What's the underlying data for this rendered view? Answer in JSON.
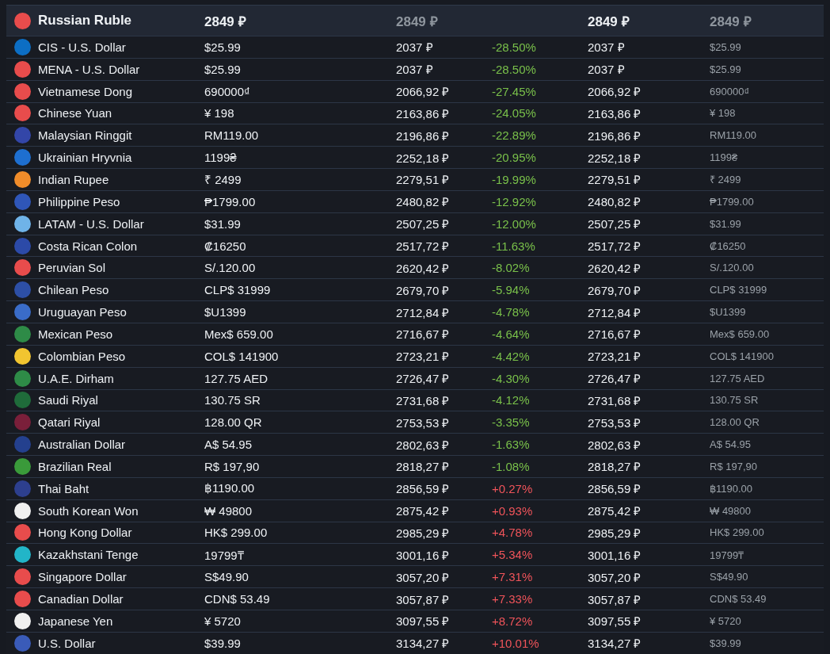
{
  "header": {
    "currency": "Russian Ruble",
    "color": "#e84c4c",
    "price": "2849 ₽",
    "converted": "2849 ₽",
    "converted_again": "2849 ₽",
    "original": "2849 ₽"
  },
  "rows": [
    {
      "currency": "CIS - U.S. Dollar",
      "color": "#0c6ec4",
      "price": "$25.99",
      "converted": "2037 ₽",
      "diff": {
        "text": "-28.50%",
        "color": "#79c04a"
      },
      "converted_again": "2037 ₽",
      "original": "$25.99"
    },
    {
      "currency": "MENA - U.S. Dollar",
      "color": "#e84c4c",
      "price": "$25.99",
      "converted": "2037 ₽",
      "diff": {
        "text": "-28.50%",
        "color": "#79c04a"
      },
      "converted_again": "2037 ₽",
      "original": "$25.99"
    },
    {
      "currency": "Vietnamese Dong",
      "color": "#e84c4c",
      "price": "690000₫",
      "converted": "2066,92 ₽",
      "diff": {
        "text": "-27.45%",
        "color": "#79c04a"
      },
      "converted_again": "2066,92 ₽",
      "original": "690000₫"
    },
    {
      "currency": "Chinese Yuan",
      "color": "#e84c4c",
      "price": "¥ 198",
      "converted": "2163,86 ₽",
      "diff": {
        "text": "-24.05%",
        "color": "#79c04a"
      },
      "converted_again": "2163,86 ₽",
      "original": "¥ 198"
    },
    {
      "currency": "Malaysian Ringgit",
      "color": "#3346a8",
      "price": "RM119.00",
      "converted": "2196,86 ₽",
      "diff": {
        "text": "-22.89%",
        "color": "#79c04a"
      },
      "converted_again": "2196,86 ₽",
      "original": "RM119.00"
    },
    {
      "currency": "Ukrainian Hryvnia",
      "color": "#1e6fd0",
      "price": "1199₴",
      "converted": "2252,18 ₽",
      "diff": {
        "text": "-20.95%",
        "color": "#79c04a"
      },
      "converted_again": "2252,18 ₽",
      "original": "1199₴"
    },
    {
      "currency": "Indian Rupee",
      "color": "#f08c2a",
      "price": "₹ 2499",
      "converted": "2279,51 ₽",
      "diff": {
        "text": "-19.99%",
        "color": "#79c04a"
      },
      "converted_again": "2279,51 ₽",
      "original": "₹ 2499"
    },
    {
      "currency": "Philippine Peso",
      "color": "#2f56b8",
      "price": "₱1799.00",
      "converted": "2480,82 ₽",
      "diff": {
        "text": "-12.92%",
        "color": "#79c04a"
      },
      "converted_again": "2480,82 ₽",
      "original": "₱1799.00"
    },
    {
      "currency": "LATAM - U.S. Dollar",
      "color": "#6fb3e8",
      "price": "$31.99",
      "converted": "2507,25 ₽",
      "diff": {
        "text": "-12.00%",
        "color": "#79c04a"
      },
      "converted_again": "2507,25 ₽",
      "original": "$31.99"
    },
    {
      "currency": "Costa Rican Colon",
      "color": "#2c4aa8",
      "price": "₡16250",
      "converted": "2517,72 ₽",
      "diff": {
        "text": "-11.63%",
        "color": "#79c04a"
      },
      "converted_again": "2517,72 ₽",
      "original": "₡16250"
    },
    {
      "currency": "Peruvian Sol",
      "color": "#e84c4c",
      "price": "S/.120.00",
      "converted": "2620,42 ₽",
      "diff": {
        "text": "-8.02%",
        "color": "#79c04a"
      },
      "converted_again": "2620,42 ₽",
      "original": "S/.120.00"
    },
    {
      "currency": "Chilean Peso",
      "color": "#2d4fa6",
      "price": "CLP$ 31999",
      "converted": "2679,70 ₽",
      "diff": {
        "text": "-5.94%",
        "color": "#79c04a"
      },
      "converted_again": "2679,70 ₽",
      "original": "CLP$ 31999"
    },
    {
      "currency": "Uruguayan Peso",
      "color": "#3a6cc8",
      "price": "$U1399",
      "converted": "2712,84 ₽",
      "diff": {
        "text": "-4.78%",
        "color": "#79c04a"
      },
      "converted_again": "2712,84 ₽",
      "original": "$U1399"
    },
    {
      "currency": "Mexican Peso",
      "color": "#2e8b47",
      "price": "Mex$ 659.00",
      "converted": "2716,67 ₽",
      "diff": {
        "text": "-4.64%",
        "color": "#79c04a"
      },
      "converted_again": "2716,67 ₽",
      "original": "Mex$ 659.00"
    },
    {
      "currency": "Colombian Peso",
      "color": "#f2c530",
      "price": "COL$ 141900",
      "converted": "2723,21 ₽",
      "diff": {
        "text": "-4.42%",
        "color": "#79c04a"
      },
      "converted_again": "2723,21 ₽",
      "original": "COL$ 141900"
    },
    {
      "currency": "U.A.E. Dirham",
      "color": "#2e8b47",
      "price": "127.75 AED",
      "converted": "2726,47 ₽",
      "diff": {
        "text": "-4.30%",
        "color": "#79c04a"
      },
      "converted_again": "2726,47 ₽",
      "original": "127.75 AED"
    },
    {
      "currency": "Saudi Riyal",
      "color": "#1f6b3a",
      "price": "130.75 SR",
      "converted": "2731,68 ₽",
      "diff": {
        "text": "-4.12%",
        "color": "#79c04a"
      },
      "converted_again": "2731,68 ₽",
      "original": "130.75 SR"
    },
    {
      "currency": "Qatari Riyal",
      "color": "#7a1f3a",
      "price": "128.00 QR",
      "converted": "2753,53 ₽",
      "diff": {
        "text": "-3.35%",
        "color": "#79c04a"
      },
      "converted_again": "2753,53 ₽",
      "original": "128.00 QR"
    },
    {
      "currency": "Australian Dollar",
      "color": "#24408e",
      "price": "A$ 54.95",
      "converted": "2802,63 ₽",
      "diff": {
        "text": "-1.63%",
        "color": "#79c04a"
      },
      "converted_again": "2802,63 ₽",
      "original": "A$ 54.95"
    },
    {
      "currency": "Brazilian Real",
      "color": "#3a9a3a",
      "price": "R$ 197,90",
      "converted": "2818,27 ₽",
      "diff": {
        "text": "-1.08%",
        "color": "#79c04a"
      },
      "converted_again": "2818,27 ₽",
      "original": "R$ 197,90"
    },
    {
      "currency": "Thai Baht",
      "color": "#2d3f8e",
      "price": "฿1190.00",
      "converted": "2856,59 ₽",
      "diff": {
        "text": "+0.27%",
        "color": "#f0545a"
      },
      "converted_again": "2856,59 ₽",
      "original": "฿1190.00"
    },
    {
      "currency": "South Korean Won",
      "color": "#f0f0f0",
      "price": "₩ 49800",
      "converted": "2875,42 ₽",
      "diff": {
        "text": "+0.93%",
        "color": "#f0545a"
      },
      "converted_again": "2875,42 ₽",
      "original": "₩ 49800"
    },
    {
      "currency": "Hong Kong Dollar",
      "color": "#e84c4c",
      "price": "HK$ 299.00",
      "converted": "2985,29 ₽",
      "diff": {
        "text": "+4.78%",
        "color": "#f0545a"
      },
      "converted_again": "2985,29 ₽",
      "original": "HK$ 299.00"
    },
    {
      "currency": "Kazakhstani Tenge",
      "color": "#22b5c8",
      "price": "19799₸",
      "converted": "3001,16 ₽",
      "diff": {
        "text": "+5.34%",
        "color": "#f0545a"
      },
      "converted_again": "3001,16 ₽",
      "original": "19799₸"
    },
    {
      "currency": "Singapore Dollar",
      "color": "#e84c4c",
      "price": "S$49.90",
      "converted": "3057,20 ₽",
      "diff": {
        "text": "+7.31%",
        "color": "#f0545a"
      },
      "converted_again": "3057,20 ₽",
      "original": "S$49.90"
    },
    {
      "currency": "Canadian Dollar",
      "color": "#e84c4c",
      "price": "CDN$ 53.49",
      "converted": "3057,87 ₽",
      "diff": {
        "text": "+7.33%",
        "color": "#f0545a"
      },
      "converted_again": "3057,87 ₽",
      "original": "CDN$ 53.49"
    },
    {
      "currency": "Japanese Yen",
      "color": "#f0f0f0",
      "price": "¥ 5720",
      "converted": "3097,55 ₽",
      "diff": {
        "text": "+8.72%",
        "color": "#f0545a"
      },
      "converted_again": "3097,55 ₽",
      "original": "¥ 5720"
    },
    {
      "currency": "U.S. Dollar",
      "color": "#3a5bb8",
      "price": "$39.99",
      "converted": "3134,27 ₽",
      "diff": {
        "text": "+10.01%",
        "color": "#f0545a"
      },
      "converted_again": "3134,27 ₽",
      "original": "$39.99"
    }
  ]
}
